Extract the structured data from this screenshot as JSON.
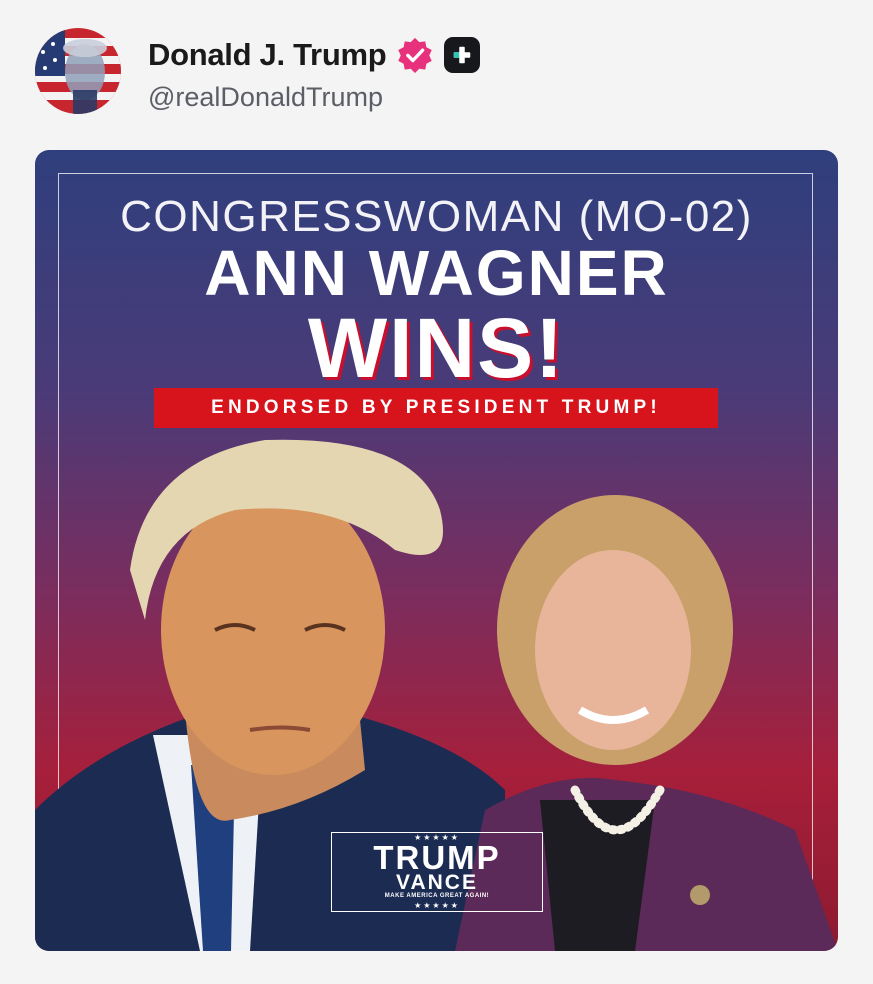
{
  "author": {
    "display_name": "Donald J. Trump",
    "handle": "@realDonaldTrump",
    "avatar_icon": "avatar-flag-portrait",
    "verified_icon": "verified-badge-icon",
    "follow_icon": "follow-plus-icon",
    "verified_color": "#e8317c"
  },
  "image": {
    "line1": "CONGRESSWOMAN (MO-02)",
    "line2": "ANN WAGNER",
    "line3": "WINS!",
    "banner": "ENDORSED BY PRESIDENT TRUMP!",
    "logo": {
      "stars": "★★★★★",
      "trump": "TRUMP",
      "vance": "VANCE",
      "slogan": "MAKE AMERICA GREAT AGAIN!"
    },
    "colors": {
      "banner_red": "#d7141c",
      "bg_top": "#2f3f7d",
      "bg_bottom": "#a71f3a"
    }
  }
}
